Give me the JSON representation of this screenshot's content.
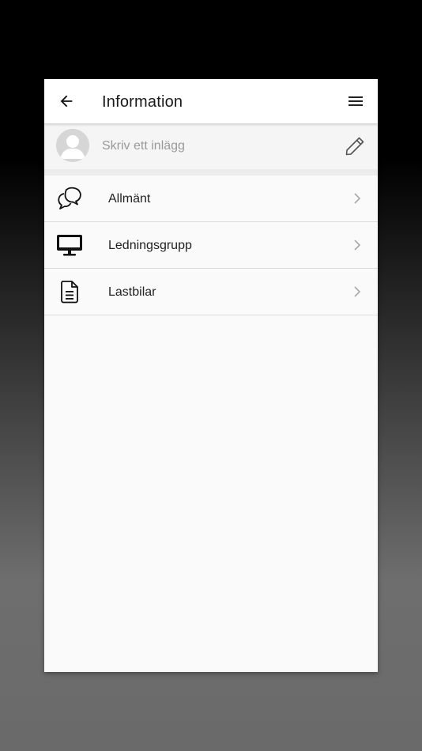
{
  "header": {
    "title": "Information",
    "back_icon": "arrow-left-icon",
    "menu_icon": "hamburger-menu-icon"
  },
  "composer": {
    "placeholder": "Skriv ett inlägg",
    "avatar_icon": "default-avatar-icon",
    "edit_icon": "pencil-icon"
  },
  "list": {
    "items": [
      {
        "label": "Allmänt",
        "icon": "chat-bubbles-icon"
      },
      {
        "label": "Ledningsgrupp",
        "icon": "desktop-monitor-icon"
      },
      {
        "label": "Lastbilar",
        "icon": "document-icon"
      }
    ],
    "chevron_icon": "chevron-right-icon"
  },
  "colors": {
    "backdrop_top": "#000000",
    "backdrop_bottom": "#6a6a6a",
    "surface": "#fafafa",
    "appbar": "#ffffff",
    "placeholder_text": "#9a9a9a",
    "divider": "#dcdcdc"
  }
}
